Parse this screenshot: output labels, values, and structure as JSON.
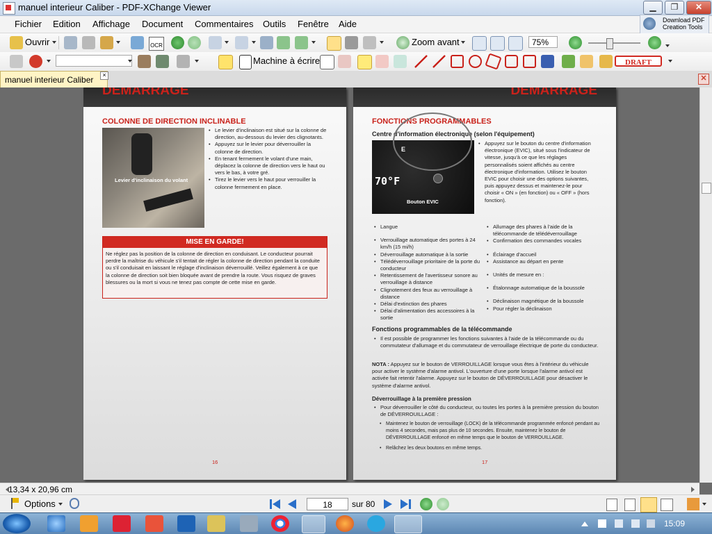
{
  "window": {
    "title": "manuel interieur Caliber - PDF-XChange Viewer",
    "minimize": "▁",
    "maximize": "❐",
    "close": "✕"
  },
  "promo": {
    "line1": "Download PDF",
    "line2": "Creation Tools"
  },
  "menu": [
    "Fichier",
    "Edition",
    "Affichage",
    "Document",
    "Commentaires",
    "Outils",
    "Fenêtre",
    "Aide"
  ],
  "toolbar1": {
    "open_label": "Ouvrir",
    "ocr_label": "OCR",
    "zoom_in_label": "Zoom avant",
    "zoom_value": "75%"
  },
  "toolbar2": {
    "search_value": "",
    "typewriter_label": "Machine à écrire",
    "stamp_label": "DRAFT"
  },
  "tab": {
    "label": "manuel interieur Caliber",
    "close": "×"
  },
  "doc_close": "✕",
  "left_page": {
    "header": "DÉMARRAGE",
    "section_title": "COLONNE DE DIRECTION INCLINABLE",
    "photo_label": "Levier d'inclinaison du volant",
    "bullets": [
      "Le levier d'inclinaison est situé sur la colonne de direction, au-dessous du levier des clignotants.",
      "Appuyez sur le levier pour déverrouiller la colonne de direction.",
      "En tenant fermement le volant d'une main, déplacez la colonne de direction vers le haut ou vers le bas, à votre gré.",
      "Tirez le levier vers le haut pour verrouiller la colonne fermement en place."
    ],
    "warning_title": "MISE EN GARDE!",
    "warning_text": "Ne réglez pas la position de la colonne de direction en conduisant. Le conducteur pourrait perdre la maîtrise du véhicule s'il tentait de régler la colonne de direction pendant la conduite ou s'il conduisait en laissant le réglage d'inclinaison déverrouillé. Veillez également à ce que la colonne de direction soit bien bloquée avant de prendre la route. Vous risquez de graves blessures ou la mort si vous ne tenez pas compte de cette mise en garde.",
    "page_number": "16"
  },
  "right_page": {
    "header": "DÉMARRAGE",
    "section_title": "FONCTIONS PROGRAMMABLES",
    "subtitle": "Centre d'information électronique (selon l'équipement)",
    "gauge_temp": "70°F",
    "gauge_fuel": "E",
    "photo_label": "Bouton EVIC",
    "evic_text": "Appuyez sur le bouton du centre d'information électronique (EVIC), situé sous l'indicateur de vitesse, jusqu'à ce que les réglages personnalisés soient affichés au centre électronique d'information. Utilisez le bouton EVIC pour choisir une des options suivantes, puis appuyez dessus et maintenez-le pour choisir « ON » (en fonction) ou « OFF » (hors fonction).",
    "options_left": [
      "Langue",
      "Verrouillage automatique des portes à 24 km/h (15 mi/h)",
      "Déverrouillage automatique à la sortie",
      "Télédéverrouillage prioritaire de la porte du conducteur",
      "Retentissement de l'avertisseur sonore au verrouillage à distance",
      "Clignotement des feux au verrouillage à distance",
      "Délai d'extinction des phares",
      "Délai d'alimentation des accessoires à la sortie"
    ],
    "options_right": [
      "Allumage des phares à l'aide de la télécommande de télédéverrouillage",
      "Confirmation des commandes vocales",
      "Éclairage d'accueil",
      "Assistance au départ en pente",
      "Unités de mesure en :",
      "Étalonnage automatique de la boussole",
      "Déclinaison magnétique de la boussole",
      "Pour régler la déclinaison"
    ],
    "remote_title": "Fonctions programmables de la télécommande",
    "remote_text": "Il est possible de programmer les fonctions suivantes à l'aide de la télécommande ou du commutateur d'allumage et du commutateur de verrouillage électrique de porte du conducteur.",
    "note_label": "NOTA :",
    "note_text": "Appuyez sur le bouton de VERROUILLAGE lorsque vous êtes à l'intérieur du véhicule pour activer le système d'alarme antivol. L'ouverture d'une porte lorsque l'alarme antivol est activée fait retentir l'alarme. Appuyez sur le bouton de DÉVERROUILLAGE pour désactiver le système d'alarme antivol.",
    "unlock_title": "Déverrouillage à la première pression",
    "unlock_text": "Pour déverrouiller le côté du conducteur, ou toutes les portes à la première pression du bouton de DÉVERROUILLAGE :",
    "unlock_sub": [
      "Maintenez le bouton de verrouillage (LOCK) de la télécommande programmée enfoncé pendant au moins 4 secondes, mais pas plus de 10 secondes. Ensuite, maintenez le bouton de DÉVERROUILLAGE enfoncé en même temps que le bouton de VERROUILLAGE.",
      "Relâchez les deux boutons en même temps."
    ],
    "page_number": "17"
  },
  "status": {
    "page_size": "13,34 x 20,96 cm",
    "options_label": "Options",
    "current_page": "18",
    "total_pages": "sur 80"
  },
  "taskbar": {
    "clock": "15:09"
  },
  "colors": {
    "accent_red": "#c9221b",
    "tab_yellow": "#fff4c5"
  }
}
